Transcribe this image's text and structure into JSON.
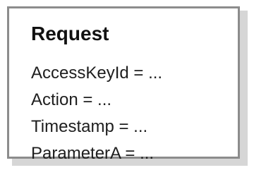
{
  "request_box": {
    "title": "Request",
    "params": [
      "AccessKeyId = ...",
      "Action = ...",
      "Timestamp = ...",
      "ParameterA = ..."
    ]
  }
}
